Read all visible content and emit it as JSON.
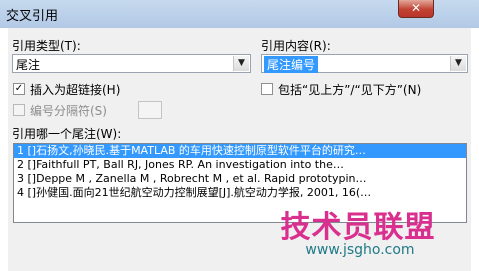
{
  "window": {
    "title": "交叉引用",
    "close_glyph": "✕"
  },
  "reference_type": {
    "label": "引用类型(T):",
    "value": "尾注"
  },
  "reference_content": {
    "label": "引用内容(R):",
    "value": "尾注编号"
  },
  "insert_hyperlink": {
    "label": "插入为超链接(H)",
    "checked": true
  },
  "include_above_below": {
    "label": "包括“见上方”/“见下方”(N)",
    "checked": false
  },
  "number_separator": {
    "label": "编号分隔符(S)",
    "enabled": false
  },
  "list": {
    "label": "引用哪一个尾注(W):",
    "items": [
      "1  []石扬文,孙晓民.基于MATLAB 的车用快速控制原型软件平台的研究…",
      "2  []Faithfull PT, Ball RJ, Jones RP. An investigation into the…",
      "3  []Deppe M , Zanella M , Robrecht M , et al. Rapid prototypin…",
      "4  []孙健国.面向21世纪航空动力控制展望[J].航空动力学报, 2001, 16(…"
    ],
    "selected_index": 0
  },
  "watermark": {
    "text": "技术员联盟",
    "url": "www.jsgho.com"
  }
}
